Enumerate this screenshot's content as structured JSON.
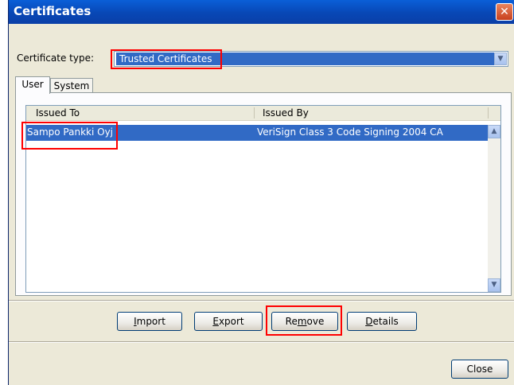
{
  "window": {
    "title": "Certificates",
    "close_glyph": "✕"
  },
  "certificate_type": {
    "label": "Certificate type:",
    "selected": "Trusted Certificates",
    "arrow": "▼"
  },
  "tabs": [
    {
      "label": "User",
      "active": true
    },
    {
      "label": "System",
      "active": false
    }
  ],
  "table": {
    "columns": [
      "Issued To",
      "Issued By"
    ],
    "rows": [
      {
        "issued_to": "Sampo Pankki Oyj",
        "issued_by": "VeriSign Class 3 Code Signing 2004 CA",
        "selected": true
      }
    ]
  },
  "scroll": {
    "up": "▲",
    "down": "▼"
  },
  "buttons": {
    "import": {
      "mnemonic": "I",
      "rest": "mport"
    },
    "export": {
      "mnemonic": "E",
      "rest": "xport"
    },
    "remove": {
      "pre": "Re",
      "mnemonic": "m",
      "rest": "ove"
    },
    "details": {
      "mnemonic": "D",
      "rest": "etails"
    },
    "close": "Close"
  },
  "colors": {
    "title_bar": "#0a4fc4",
    "selection": "#316ac5",
    "highlight_box": "#ff0000",
    "dialog_bg": "#ece9d8"
  }
}
